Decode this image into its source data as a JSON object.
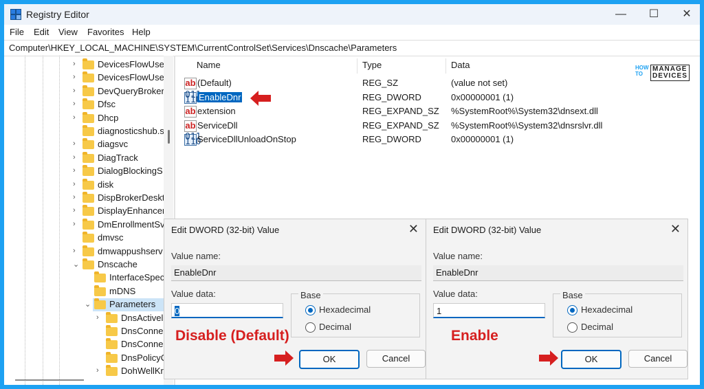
{
  "window": {
    "title": "Registry Editor",
    "controls": {
      "minimize": "—",
      "maximize": "☐",
      "close": "✕"
    }
  },
  "menu": [
    "File",
    "Edit",
    "View",
    "Favorites",
    "Help"
  ],
  "address": "Computer\\HKEY_LOCAL_MACHINE\\SYSTEM\\CurrentControlSet\\Services\\Dnscache\\Parameters",
  "tree": [
    {
      "label": "DevicesFlowUser",
      "chev": "›"
    },
    {
      "label": "DevicesFlowUser",
      "chev": "›"
    },
    {
      "label": "DevQueryBroker",
      "chev": "›"
    },
    {
      "label": "Dfsc",
      "chev": "›"
    },
    {
      "label": "Dhcp",
      "chev": "›"
    },
    {
      "label": "diagnosticshub.s",
      "chev": ""
    },
    {
      "label": "diagsvc",
      "chev": "›"
    },
    {
      "label": "DiagTrack",
      "chev": "›"
    },
    {
      "label": "DialogBlockingS",
      "chev": "›"
    },
    {
      "label": "disk",
      "chev": "›"
    },
    {
      "label": "DispBrokerDeskt",
      "chev": "›"
    },
    {
      "label": "DisplayEnhancer",
      "chev": "›"
    },
    {
      "label": "DmEnrollmentSv",
      "chev": "›"
    },
    {
      "label": "dmvsc",
      "chev": ""
    },
    {
      "label": "dmwappushserv",
      "chev": "›"
    },
    {
      "label": "Dnscache",
      "chev": "⌄"
    },
    {
      "label": "InterfaceSpec",
      "chev": ""
    },
    {
      "label": "mDNS",
      "chev": ""
    },
    {
      "label": "Parameters",
      "chev": "⌄"
    },
    {
      "label": "DnsActivel",
      "chev": "›"
    },
    {
      "label": "DnsConne",
      "chev": ""
    },
    {
      "label": "DnsConne",
      "chev": ""
    },
    {
      "label": "DnsPolicyC",
      "chev": ""
    },
    {
      "label": "DohWellKr",
      "chev": "›"
    }
  ],
  "columns": {
    "name": "Name",
    "type": "Type",
    "data": "Data"
  },
  "values": [
    {
      "name": "(Default)",
      "type": "REG_SZ",
      "data": "(value not set)",
      "icon": "string-value-icon"
    },
    {
      "name": "EnableDnr",
      "type": "REG_DWORD",
      "data": "0x00000001 (1)",
      "icon": "binary-value-icon"
    },
    {
      "name": "extension",
      "type": "REG_EXPAND_SZ",
      "data": "%SystemRoot%\\System32\\dnsext.dll",
      "icon": "string-value-icon"
    },
    {
      "name": "ServiceDll",
      "type": "REG_EXPAND_SZ",
      "data": "%SystemRoot%\\System32\\dnsrslvr.dll",
      "icon": "string-value-icon"
    },
    {
      "name": "ServiceDllUnloadOnStop",
      "type": "REG_DWORD",
      "data": "0x00000001 (1)",
      "icon": "binary-value-icon"
    }
  ],
  "logo": {
    "how": "HOW",
    "to": "TO",
    "manage": "MANAGE",
    "devices": "DEVICES"
  },
  "dialogs": [
    {
      "title": "Edit DWORD (32-bit) Value",
      "value_name_label": "Value name:",
      "value_name": "EnableDnr",
      "value_data_label": "Value data:",
      "value_data": "0",
      "base_label": "Base",
      "hex_label": "Hexadecimal",
      "dec_label": "Decimal",
      "selected_base": "Hexadecimal",
      "ok": "OK",
      "cancel": "Cancel",
      "caption": "Disable (Default)"
    },
    {
      "title": "Edit DWORD (32-bit) Value",
      "value_name_label": "Value name:",
      "value_name": "EnableDnr",
      "value_data_label": "Value data:",
      "value_data": "1",
      "base_label": "Base",
      "hex_label": "Hexadecimal",
      "dec_label": "Decimal",
      "selected_base": "Hexadecimal",
      "ok": "OK",
      "cancel": "Cancel",
      "caption": "Enable"
    }
  ],
  "colors": {
    "accent": "#0067c0",
    "annotation": "#d61f1f",
    "background": "#1da1f2"
  }
}
